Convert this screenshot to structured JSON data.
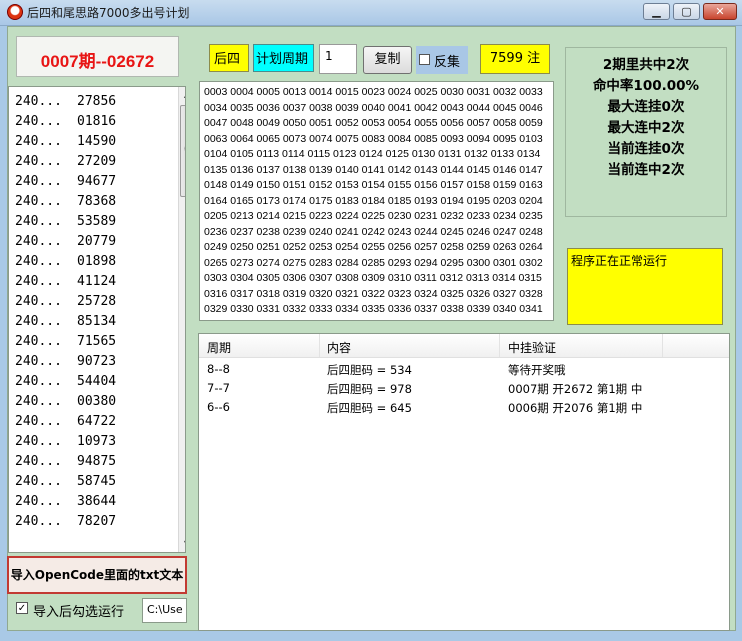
{
  "window": {
    "title": "后四和尾思路7000多出号计划",
    "minimize": "▁",
    "maximize": "▢",
    "close": "✕"
  },
  "issue": "0007期--02672",
  "code_list": [
    {
      "id": "240...",
      "code": "27856"
    },
    {
      "id": "240...",
      "code": "01816"
    },
    {
      "id": "240...",
      "code": "14590"
    },
    {
      "id": "240...",
      "code": "27209"
    },
    {
      "id": "240...",
      "code": "94677"
    },
    {
      "id": "240...",
      "code": "78368"
    },
    {
      "id": "240...",
      "code": "53589"
    },
    {
      "id": "240...",
      "code": "20779"
    },
    {
      "id": "240...",
      "code": "01898"
    },
    {
      "id": "240...",
      "code": "41124"
    },
    {
      "id": "240...",
      "code": "25728"
    },
    {
      "id": "240...",
      "code": "85134"
    },
    {
      "id": "240...",
      "code": "71565"
    },
    {
      "id": "240...",
      "code": "90723"
    },
    {
      "id": "240...",
      "code": "54404"
    },
    {
      "id": "240...",
      "code": "00380"
    },
    {
      "id": "240...",
      "code": "64722"
    },
    {
      "id": "240...",
      "code": "10973"
    },
    {
      "id": "240...",
      "code": "94875"
    },
    {
      "id": "240...",
      "code": "58745"
    },
    {
      "id": "240...",
      "code": "38644"
    },
    {
      "id": "240...",
      "code": "78207"
    }
  ],
  "scrollbar": {
    "up": "▲",
    "down": "▼",
    "grip": "≡"
  },
  "import_button": "导入OpenCode里面的txt文本",
  "auto_run": {
    "checked": "✓",
    "label": "导入后勾选运行"
  },
  "path_value": "C:\\Use",
  "controls": {
    "position": "后四",
    "cycle_label": "计划周期",
    "cycle_value": "1",
    "copy": "复制",
    "reverse": "反集",
    "count": "7599 注"
  },
  "numbers": "0003 0004 0005 0013 0014 0015 0023 0024 0025 0030 0031 0032 0033 0034 0035 0036 0037 0038 0039 0040 0041 0042 0043 0044 0045 0046 0047 0048 0049 0050 0051 0052 0053 0054 0055 0056 0057 0058 0059 0063 0064 0065 0073 0074 0075 0083 0084 0085 0093 0094 0095 0103 0104 0105 0113 0114 0115 0123 0124 0125 0130 0131 0132 0133 0134 0135 0136 0137 0138 0139 0140 0141 0142 0143 0144 0145 0146 0147 0148 0149 0150 0151 0152 0153 0154 0155 0156 0157 0158 0159 0163 0164 0165 0173 0174 0175 0183 0184 0185 0193 0194 0195 0203 0204 0205 0213 0214 0215 0223 0224 0225 0230 0231 0232 0233 0234 0235 0236 0237 0238 0239 0240 0241 0242 0243 0244 0245 0246 0247 0248 0249 0250 0251 0252 0253 0254 0255 0256 0257 0258 0259 0263 0264 0265 0273 0274 0275 0283 0284 0285 0293 0294 0295 0300 0301 0302 0303 0304 0305 0306 0307 0308 0309 0310 0311 0312 0313 0314 0315 0316 0317 0318 0319 0320 0321 0322 0323 0324 0325 0326 0327 0328 0329 0330 0331 0332 0333 0334 0335 0336 0337 0338 0339 0340 0341",
  "stats": [
    "2期里共中2次",
    "命中率100.00%",
    "最大连挂0次",
    "最大连中2次",
    "当前连挂0次",
    "当前连中2次"
  ],
  "status": "程序正在正常运行",
  "table": {
    "headers": [
      "周期",
      "内容",
      "中挂验证"
    ],
    "rows": [
      {
        "period": "8--8",
        "content": "后四胆码 = 534",
        "verify": "等待开奖哦"
      },
      {
        "period": "7--7",
        "content": "后四胆码 = 978",
        "verify": "0007期 开2672 第1期 中"
      },
      {
        "period": "6--6",
        "content": "后四胆码 = 645",
        "verify": "0006期 开2076 第1期 中"
      }
    ]
  },
  "colors": {
    "issue_red": "#e81515",
    "yellow": "#ffff00",
    "cyan": "#00ffff",
    "panel_green": "#c2dec2"
  }
}
